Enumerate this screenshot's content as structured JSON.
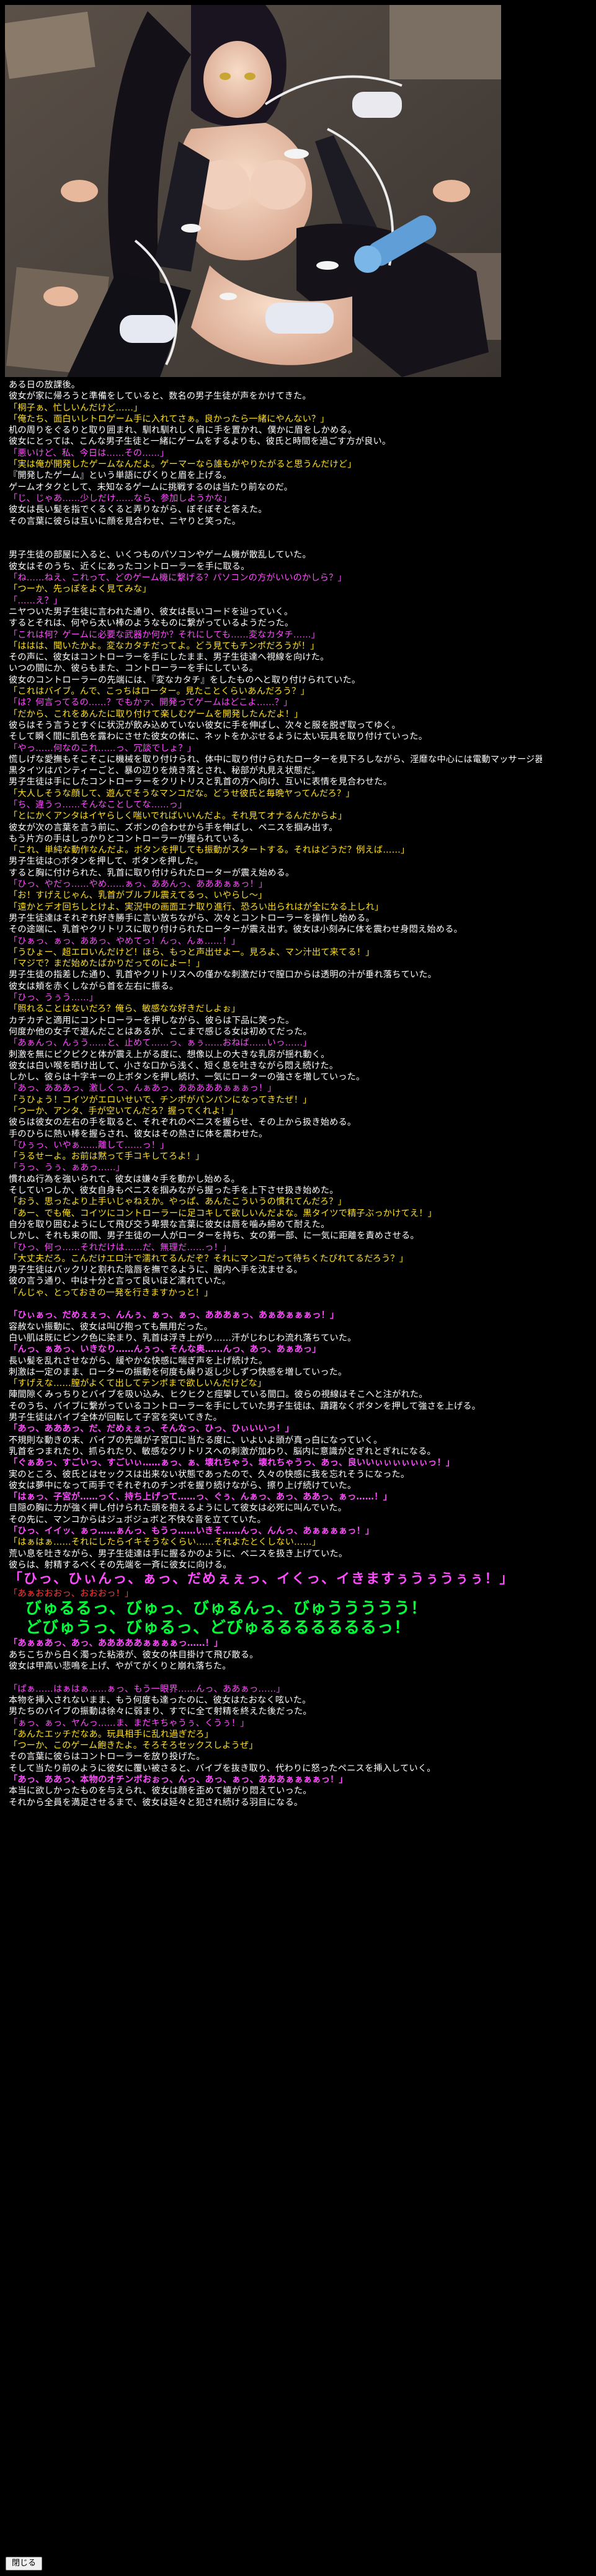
{
  "close_button": "閉じる",
  "lines": [
    {
      "c": "n",
      "t": "ある日の放課後。"
    },
    {
      "c": "n",
      "t": "彼女が家に帰ろうと準備をしていると、数名の男子生徒が声をかけてきた。"
    },
    {
      "c": "y",
      "t": "「桐子ぁ、忙しいんだけど……」"
    },
    {
      "c": "y",
      "t": "「俺たち、面白いレトロゲーム手に入れてさぁ。良かったら一緒にやんない？」"
    },
    {
      "c": "n",
      "t": "机の周りをぐるりと取り囲まれ、馴れ馴れしく肩に手を置かれ、僕かに眉をしかめる。"
    },
    {
      "c": "n",
      "t": "彼女にとっては、こんな男子生徒と一緒にゲームをするよりも、彼氏と時間を過ごす方が良い。"
    },
    {
      "c": "m",
      "t": "「悪いけど、私、今日は……その……」"
    },
    {
      "c": "y",
      "t": "「実は俺が開発したゲームなんだよ。ゲーマーなら誰もがやりたがると思うんだけど」"
    },
    {
      "c": "n",
      "t": "『開発したゲーム』という単語にぴくりと眉を上げる。"
    },
    {
      "c": "n",
      "t": "ゲームオタクとして、未知なるゲームに挑戦するのは当たり前なのだ。"
    },
    {
      "c": "m",
      "t": "「じ、じゃあ……少しだけ……なら、参加しようかな」"
    },
    {
      "c": "n",
      "t": "彼女は長い髪を指でくるくると弄りながら、ぼそぼそと答えた。"
    },
    {
      "c": "n",
      "t": "その言葉に彼らは互いに顔を見合わせ、ニヤりと笑った。"
    },
    {
      "c": "gap",
      "t": ""
    },
    {
      "c": "gap",
      "t": ""
    },
    {
      "c": "n",
      "t": "男子生徒の部屋に入ると、いくつものパソコンやゲーム機が散乱していた。"
    },
    {
      "c": "n",
      "t": "彼女はそのうち、近くにあったコントローラーを手に取る。"
    },
    {
      "c": "m",
      "t": "「ね……ねえ、これって、どのゲーム機に繋げる？パソコンの方がいいのかしら？」"
    },
    {
      "c": "y",
      "t": "「つーか、先っぽをよく見てみな」"
    },
    {
      "c": "m",
      "t": "「……え？」"
    },
    {
      "c": "n",
      "t": "ニヤついた男子生徒に言われた通り、彼女は長いコードを辿っていく。"
    },
    {
      "c": "n",
      "t": "するとそれは、何やら太い棒のようなものに繋がっているようだった。"
    },
    {
      "c": "m",
      "t": "「これは何？ゲームに必要な武器か何か？それにしても……変なカタチ……」"
    },
    {
      "c": "y",
      "t": "「ははは、聞いたかよ。変なカタチだってよ。どう見てもチンポだろうが！」"
    },
    {
      "c": "n",
      "t": "その声に、彼女はコントローラーを手にしたまま、男子生徒達へ視線を向けた。"
    },
    {
      "c": "n",
      "t": "いつの間にか、彼らもまた、コントローラーを手にしている。"
    },
    {
      "c": "n",
      "t": "彼女のコントローラーの先端には、『変なカタチ』をしたものへと取り付けられていた。"
    },
    {
      "c": "y",
      "t": "「これはバイブ。んで、こっちはローター。見たことくらいあんだろう？」"
    },
    {
      "c": "m",
      "t": "「は？何言ってるの……？でもかァ、開発ってゲームはどこよ……？」"
    },
    {
      "c": "y",
      "t": "「だから、これをあんたに取り付けて楽しむゲームを開発したんだよ！」"
    },
    {
      "c": "n",
      "t": "彼らはそう言うとすぐに状況が飲み込めていない彼女に手を伸ばし、次々と服を脱ぎ取ってゆく。"
    },
    {
      "c": "n",
      "t": "そして瞬く間に肌色を露わにさせた彼女の体に、ネットをかぶせるように太い玩具を取り付けていった。"
    },
    {
      "c": "m",
      "t": "「やっ……何なのこれ……っ、冗談でしょ？」"
    },
    {
      "c": "n",
      "t": "慌しげな愛撫もそこそこに機械を取り付けられ、体中に取り付けられたローターを見下ろしながら、淫靡な中心には電動マッサージ器が振りつけられた。"
    },
    {
      "c": "n",
      "t": "黒タイツはパンティーごと、暴の辺りを焼き落とされ、秘部が丸見え状態だ。"
    },
    {
      "c": "n",
      "t": "男子生徒は手にしたコントローラーをクリトリスと乳首の方へ向け、互いに表情を見合わせた。"
    },
    {
      "c": "y",
      "t": "「大人しそうな顔して、遊んでそうなマンコだな。どうせ彼氏と毎晩ヤってんだろ？」"
    },
    {
      "c": "m",
      "t": "「ち、違うっ……そんなことしてな……っ」"
    },
    {
      "c": "y",
      "t": "「とにかくアンタはイヤらしく喘いでればいいんだよ。それ見てオナるんだからよ」"
    },
    {
      "c": "n",
      "t": "彼女が次の言葉を言う前に、ズボンの合わせから手を伸ばし、ペニスを掴み出す。"
    },
    {
      "c": "n",
      "t": "もう片方の手はしっかりとコントローラーが握られている。"
    },
    {
      "c": "y",
      "t": "「これ、単純な動作なんだよ。ボタンを押しても振動がスタートする。それはどうだ？例えば……」"
    },
    {
      "c": "n",
      "t": "男子生徒は○ボタンを押して、ボタンを押した。"
    },
    {
      "c": "n",
      "t": "すると胸に付けられた、乳首に取り付けられたローターが震え始める。"
    },
    {
      "c": "m",
      "t": "「ひっ、やだっ……やめ……ぁっ、ああんっ、あああぁぁっ！」"
    },
    {
      "c": "y",
      "t": "「お！すげえじゃん、乳首がブルブル震えてるっ、いやらし～」"
    },
    {
      "c": "y",
      "t": "「遠かとデオ回ちしとけよ、実況中の画面エナ取り進行、恐ろい出られはが全になる上しれ」"
    },
    {
      "c": "n",
      "t": "男子生徒達はそれぞれ好き勝手に言い放ちながら、次々とコントローラーを操作し始める。"
    },
    {
      "c": "n",
      "t": "その途端に、乳首やクリトリスに取り付けられたローターが震え出す。彼女は小刻みに体を震わせ身悶え始める。"
    },
    {
      "c": "m",
      "t": "「ひぁっ、ぁっ、ああっ、やめてっ！んっ、んぁ……！」"
    },
    {
      "c": "y",
      "t": "「うひょー、超エロいんだけど！ほら、もっと声出せよー。見ろよ、マン汁出て来てる！」"
    },
    {
      "c": "y",
      "t": "「マジで？まだ始めたばかりだってのによー！」"
    },
    {
      "c": "n",
      "t": "男子生徒の指差した通り、乳首やクリトリスへの僅かな刺激だけで膣口からは透明の汁が垂れ落ちていた。"
    },
    {
      "c": "n",
      "t": "彼女は頬を赤くしながら首を左右に振る。"
    },
    {
      "c": "m",
      "t": "「ひっ、うぅう……」"
    },
    {
      "c": "y",
      "t": "「照れることはないだろ？俺ら、敏感なな好きだしよぉ」"
    },
    {
      "c": "n",
      "t": "カチカチと適用にコントローラーを押しながら、彼らは下品に笑った。"
    },
    {
      "c": "n",
      "t": "何度か他の女子で遊んだことはあるが、ここまで感じる女は初めてだった。"
    },
    {
      "c": "m",
      "t": "「あぁんっ、んぅう……と、止めて……っ、ぁぅ……おねば……いっ……」"
    },
    {
      "c": "n",
      "t": "刺激を無にピクピクと体が震え上がる度に、想像以上の大きな乳房が揺れ動く。"
    },
    {
      "c": "n",
      "t": "彼女は白い喉を晒け出して、小さな口から浅く、短く息を吐きながら悶え続けた。"
    },
    {
      "c": "n",
      "t": "しかし、彼らは十字キーの上ボタンを押し続け、一気にローターの強さを増していった。"
    },
    {
      "c": "m",
      "t": "「あっ、あああっ、激しくっ、んぁあっ、あああああぁぁぁっ！」"
    },
    {
      "c": "y",
      "t": "「うひょう！コイツがエロいせいで、チンポがパンパンになってきたぜ！」"
    },
    {
      "c": "y",
      "t": "「つーか、アンタ、手が空いてんだろ？握ってくれよ！」"
    },
    {
      "c": "n",
      "t": "彼らは彼女の左右の手を取ると、それぞれのペニスを握らせ、その上から扱き始める。"
    },
    {
      "c": "n",
      "t": "手のひらに熱い棒を握らされ、彼女はその熱さに体を震わせた。"
    },
    {
      "c": "m",
      "t": "「ひぅっ、いやぁ……離して……っ！」"
    },
    {
      "c": "y",
      "t": "「うるせーよ。お前は黙って手コキしてろよ！」"
    },
    {
      "c": "m",
      "t": "「うっ、うぅ、ぁあっ……」"
    },
    {
      "c": "n",
      "t": "慣れぬ行為を強いられて、彼女は嫌々手を動かし始める。"
    },
    {
      "c": "n",
      "t": "そしていつしか、彼女自身もペニスを掴みながら握った手を上下させ扱き始めた。"
    },
    {
      "c": "y",
      "t": "「おう、思ったより上手いじゃねえか。やっぱ、あんたこういうの慣れてんだろ？」"
    },
    {
      "c": "y",
      "t": "「あー、でも俺、コイツにコントローラーに足コキして欲しいんだよな。黒タイツで精子ぶっかけてえ！」"
    },
    {
      "c": "n",
      "t": "自分を取り囲むようにして飛び交う卑猥な言葉に彼女は唇を噛み締めて耐えた。"
    },
    {
      "c": "n",
      "t": "しかし、それも束の間、男子生徒の一人がローターを持ち、女の第一部、に一気に距離を責めさせる。"
    },
    {
      "c": "m",
      "t": "「ひっ、何っ……それだけは……だ、無理だ……っ！」"
    },
    {
      "c": "y",
      "t": "「大丈夫だろ。こんだけエロ汁で濡れてるんだぞ？それにマンコだって待ちくたびれてるだろう？」"
    },
    {
      "c": "n",
      "t": "男子生徒はバックリと割れた陰唇を撫でるように、膣内へ手を沈ませる。"
    },
    {
      "c": "n",
      "t": "彼の言う通り、中は十分と言って良いほど濡れていた。"
    },
    {
      "c": "y",
      "t": "「んじゃ、とっておきの一発を行きますかっと！」"
    },
    {
      "c": "gap",
      "t": ""
    },
    {
      "c": "m bold",
      "t": "「ひぃぁっ、だめぇぇっ、んんぅ、ぁっ、ぁっ、あああぁっ、あぁあぁぁぁっ！」"
    },
    {
      "c": "n",
      "t": "容赦ない振動に、彼女は叫び抱っても無用だった。"
    },
    {
      "c": "n",
      "t": "白い肌は既にピンク色に染まり、乳首は浮き上がり……汗がじわじわ流れ落ちていた。"
    },
    {
      "c": "m bold",
      "t": "「んっ、ぁあっ、いきなり……んぅっ、そんな奥……んっ、あっ、あぁあっ」"
    },
    {
      "c": "n",
      "t": "長い髪を乱れさせながら、緩やかな快感に喘ぎ声を上げ続けた。"
    },
    {
      "c": "n",
      "t": "刺激は一定のまま、ローターの振動を何度も繰り返し少しずつ快感を増していった。"
    },
    {
      "c": "y",
      "t": "「すげえな……膣がよくて出してテンポまで欲しいんだけどな」"
    },
    {
      "c": "n",
      "t": "陣間隙くみっちりとバイブを吸い込み、ヒクヒクと痙攣している間口。彼らの視線はそこへと注がれた。"
    },
    {
      "c": "n",
      "t": "そのうち、バイブに繋がっているコントローラーを手にしていた男子生徒は、躊躇なくボタンを押して強さを上げる。"
    },
    {
      "c": "n",
      "t": "男子生徒はバイブ全体が回転して子宮を突いてきた。"
    },
    {
      "c": "m bold",
      "t": "「あっ、あああっ、だ、だめぇぇっ、そんなっ、ひっ、ひぃいいっ！」"
    },
    {
      "c": "n",
      "t": "不規則な動きの末、バイブの先端が子宮口に当たる度に、いよいよ頭が真っ白になっていく。"
    },
    {
      "c": "n",
      "t": "乳首をつまれたり、抓られたり、敏感なクリトリスへの刺激が加わり、脳内に意識がとぎれとぎれになる。"
    },
    {
      "c": "m bold",
      "t": "「ぐぁあっ、すごいっ、すごいぃ……ぁっ、ぁ、壊れちゃう、壊れちゃうっ、あっ、良いいぃぃぃぃぃぃっ！」"
    },
    {
      "c": "n",
      "t": "実のところ、彼氏とはセックスは出来ない状態であったので、久々の快感に我を忘れそうになった。"
    },
    {
      "c": "n",
      "t": "彼女は夢中になって両手でそれぞれのチンポを握り続けながら、擦り上げ続けていた。"
    },
    {
      "c": "m bold",
      "t": "「はぁっ、子宮が……っく、持ち上げって……っ、ぐぅ、んぁっ、あっ、ああっ、ぁっ……！」"
    },
    {
      "c": "n",
      "t": "目隠の胸に力が強く押し付けられた頭を抱えるようにして彼女は必死に叫んでいた。"
    },
    {
      "c": "n",
      "t": "その先に、マンコからはジュボジュボと不快な音を立てていた。"
    },
    {
      "c": "m bold",
      "t": "「ひっ、イイッ、ぁっ……ぁんっ、もうっ……いきそ……んっ、んんっ、あぁぁぁぁっ！」"
    },
    {
      "c": "y",
      "t": "「はぁはぁ……それにしたらイキそうなくらい……それよたとくしない……」"
    },
    {
      "c": "n",
      "t": "荒い息を吐きながら、男子生徒達は手に握るかのように、ペニスを扱き上げていた。"
    },
    {
      "c": "n",
      "t": "彼らは、射精するべくその先端を一斉に彼女に向ける。"
    },
    {
      "c": "m bold big2",
      "t": "「ひっ、ひぃんっ、ぁっ、だめぇぇっ、イくっ、イきますぅうぅうぅぅ！」"
    },
    {
      "c": "r",
      "t": "「あぁおおおっ、おおおっ！」"
    },
    {
      "c": "g bold big",
      "t": "　びゅるるっ、びゅっ、びゅるんっ、びゅううううう！"
    },
    {
      "c": "g bold big",
      "t": "　どびゅうっ、びゅるっ、どぴゅるるるるるるるっ！"
    },
    {
      "c": "m bold",
      "t": "「あぁぁあっ、あっ、あああああぁぁぁぁっ……！」"
    },
    {
      "c": "n",
      "t": "あちこちから白く濁った粘液が、彼女の体目掛けて飛び散る。"
    },
    {
      "c": "n",
      "t": "彼女は甲高い悲鳴を上げ、やがてがくりと崩れ落ちた。"
    },
    {
      "c": "gap",
      "t": ""
    },
    {
      "c": "m",
      "t": "「ぱぁ……はぁはぁ……ぁっ、もう一眼界……んっ、ああぁっ……」"
    },
    {
      "c": "n",
      "t": "本物を挿入されないまま、もう何度も達ったのに、彼女はたおなく呟いた。"
    },
    {
      "c": "n",
      "t": "男たちのバイブの振動は徐々に弱まり、すでに全て射精を終えた後だった。"
    },
    {
      "c": "m",
      "t": "「ぁっ、ぁっ、ヤんっ……ま、まだキちゃうぅ、くうぅ！」"
    },
    {
      "c": "y",
      "t": "「あんたエッチだなあ。玩具相手に乱れ過ぎだろ」"
    },
    {
      "c": "y",
      "t": "「つーか、このゲーム飽きたよ。そろそろセックスしようぜ」"
    },
    {
      "c": "n",
      "t": "その言葉に彼らはコントローラーを放り投げた。"
    },
    {
      "c": "n",
      "t": "そして当たり前のように彼女に覆い被さると、バイブを抜き取り、代わりに怒ったペニスを挿入していく。"
    },
    {
      "c": "m bold",
      "t": "「あっ、ああっ、本物のオチンポおぉっ、んっ、あっ、ぁっ、あああぁぁぁぁっ！」"
    },
    {
      "c": "n",
      "t": "本当に欲しかったものを与えられ、彼女は顔を歪めて嬉がり悶えていった。"
    },
    {
      "c": "n",
      "t": "それから全員を満足させるまで、彼女は延々と犯され続ける羽目になる。"
    }
  ]
}
